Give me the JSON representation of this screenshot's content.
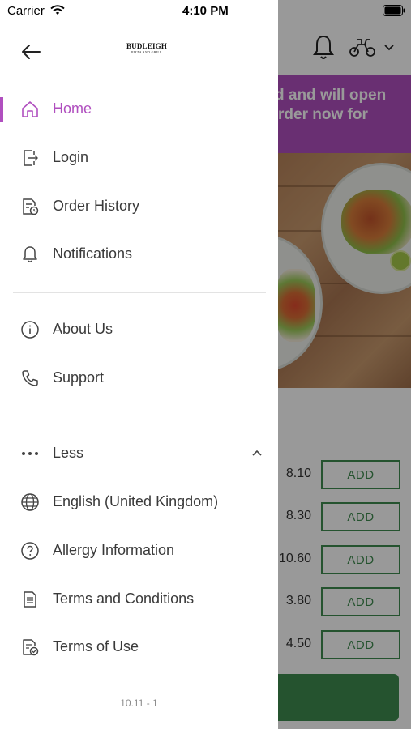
{
  "status_bar": {
    "carrier": "Carrier",
    "time": "4:10 PM"
  },
  "drawer": {
    "logo_title": "BUDLEIGH",
    "logo_subtitle": "PIZZA AND GRILL",
    "active_color": "#b04fbf",
    "items_primary": [
      {
        "label": "Home",
        "icon": "home-icon",
        "active": true
      },
      {
        "label": "Login",
        "icon": "login-icon"
      },
      {
        "label": "Order History",
        "icon": "order-history-icon"
      },
      {
        "label": "Notifications",
        "icon": "bell-icon"
      }
    ],
    "items_info": [
      {
        "label": "About Us",
        "icon": "info-icon"
      },
      {
        "label": "Support",
        "icon": "phone-icon"
      }
    ],
    "more_toggle": {
      "label": "Less",
      "icon": "more-dots-icon",
      "expanded": true
    },
    "items_more": [
      {
        "label": "English (United Kingdom)",
        "icon": "globe-icon"
      },
      {
        "label": "Allergy Information",
        "icon": "question-circle-icon"
      },
      {
        "label": "Terms and Conditions",
        "icon": "document-icon"
      },
      {
        "label": "Terms of Use",
        "icon": "document-check-icon"
      }
    ],
    "version": "10.11 - 1"
  },
  "background": {
    "banner_line1": "d and will open",
    "banner_line2": "rder now for",
    "banner_color": "#b04fbf",
    "add_label": "ADD",
    "accent_green": "#3f8b4f",
    "prices": [
      "8.10",
      "8.30",
      "10.60",
      "3.80",
      "4.50"
    ]
  }
}
